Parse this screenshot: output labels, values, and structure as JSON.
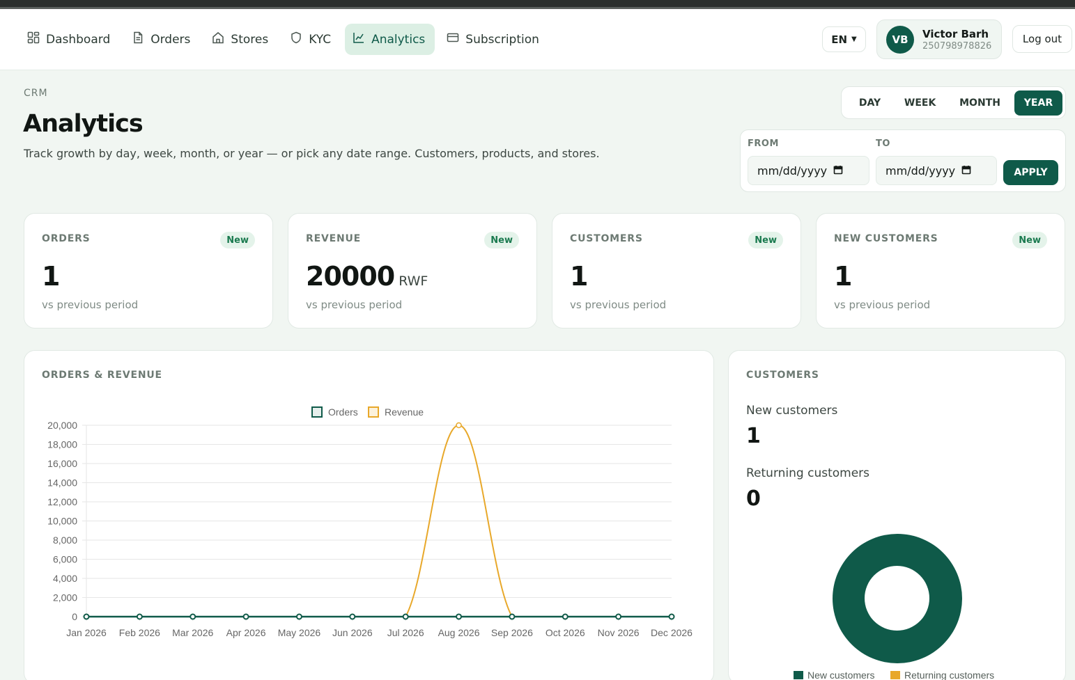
{
  "nav": {
    "items": [
      {
        "label": "Dashboard"
      },
      {
        "label": "Orders"
      },
      {
        "label": "Stores"
      },
      {
        "label": "KYC"
      },
      {
        "label": "Analytics"
      },
      {
        "label": "Subscription"
      }
    ],
    "active": "Analytics",
    "language": "EN",
    "user_initials": "VB",
    "user_name": "Victor Barh",
    "user_phone": "250798978826",
    "logout_label": "Log out"
  },
  "page": {
    "breadcrumb": "CRM",
    "title": "Analytics",
    "subtitle": "Track growth by day, week, month, or year — or pick any date range. Customers, products, and stores."
  },
  "periods": {
    "options": [
      "DAY",
      "WEEK",
      "MONTH",
      "YEAR"
    ],
    "selected": "YEAR"
  },
  "range": {
    "from_label": "FROM",
    "to_label": "TO",
    "from_placeholder": "mm/dd/yyyy",
    "to_placeholder": "mm/dd/yyyy",
    "apply_label": "APPLY"
  },
  "stats": [
    {
      "label": "ORDERS",
      "badge": "New",
      "value": "1",
      "unit": "",
      "sub": "vs previous period"
    },
    {
      "label": "REVENUE",
      "badge": "New",
      "value": "20000",
      "unit": "RWF",
      "sub": "vs previous period"
    },
    {
      "label": "CUSTOMERS",
      "badge": "New",
      "value": "1",
      "unit": "",
      "sub": "vs previous period"
    },
    {
      "label": "NEW CUSTOMERS",
      "badge": "New",
      "value": "1",
      "unit": "",
      "sub": "vs previous period"
    }
  ],
  "orders_revenue": {
    "title": "ORDERS & REVENUE"
  },
  "customers": {
    "title": "CUSTOMERS",
    "new_label": "New customers",
    "new_value": "1",
    "returning_label": "Returning customers",
    "returning_value": "0"
  },
  "colors": {
    "brand": "#0f5a49",
    "revenue": "#e8a82a",
    "badge_bg": "#e4f3ea",
    "badge_text": "#1a7a4f"
  },
  "chart_data": [
    {
      "type": "line",
      "categories": [
        "Jan 2026",
        "Feb 2026",
        "Mar 2026",
        "Apr 2026",
        "May 2026",
        "Jun 2026",
        "Jul 2026",
        "Aug 2026",
        "Sep 2026",
        "Oct 2026",
        "Nov 2026",
        "Dec 2026"
      ],
      "series": [
        {
          "name": "Orders",
          "values": [
            0,
            0,
            0,
            0,
            0,
            0,
            0,
            1,
            0,
            0,
            0,
            0
          ],
          "color": "#0f5a49"
        },
        {
          "name": "Revenue",
          "values": [
            0,
            0,
            0,
            0,
            0,
            0,
            0,
            20000,
            0,
            0,
            0,
            0
          ],
          "color": "#e8a82a"
        }
      ],
      "yticks": [
        "20,000",
        "18,000",
        "16,000",
        "14,000",
        "12,000",
        "10,000",
        "8,000",
        "6,000",
        "4,000",
        "2,000",
        "0"
      ],
      "ylim": [
        0,
        20000
      ],
      "legend": "top-center",
      "grid": true
    },
    {
      "type": "pie",
      "categories": [
        "New customers",
        "Returning customers"
      ],
      "values": [
        1,
        0
      ],
      "colors": [
        "#0f5a49",
        "#e8a82a"
      ],
      "legend": "bottom-center"
    }
  ]
}
